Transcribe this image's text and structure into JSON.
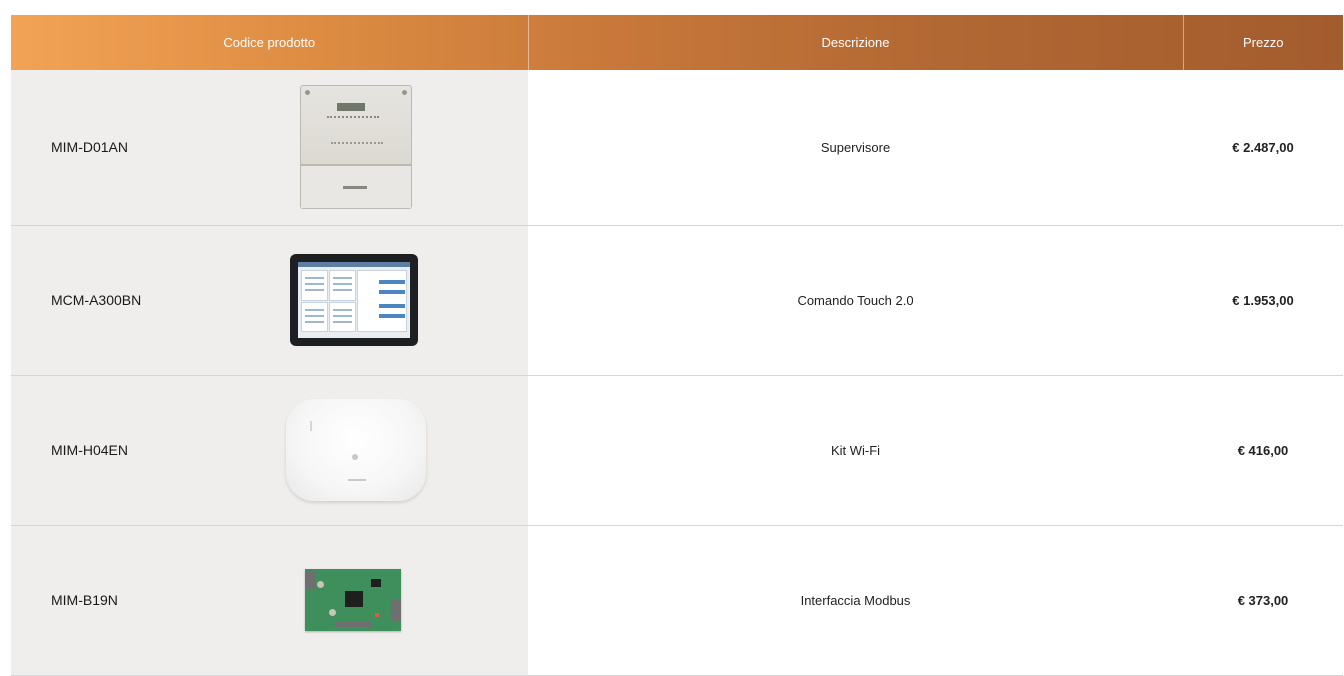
{
  "table": {
    "headers": {
      "code": "Codice prodotto",
      "description": "Descrizione",
      "price": "Prezzo"
    },
    "rows": [
      {
        "code": "MIM-D01AN",
        "description": "Supervisore",
        "price": "€ 2.487,00",
        "image": "wall-controller-image"
      },
      {
        "code": "MCM-A300BN",
        "description": "Comando Touch 2.0",
        "price": "€ 1.953,00",
        "image": "touch-tablet-image"
      },
      {
        "code": "MIM-H04EN",
        "description": "Kit Wi-Fi",
        "price": "€ 416,00",
        "image": "wifi-kit-image"
      },
      {
        "code": "MIM-B19N",
        "description": "Interfaccia Modbus",
        "price": "€ 373,00",
        "image": "modbus-board-image"
      }
    ]
  },
  "colors": {
    "header_gradient_start": "#f3a356",
    "header_gradient_end": "#a35c2e",
    "code_column_bg": "#efeeec",
    "header_text": "#ffffff"
  }
}
